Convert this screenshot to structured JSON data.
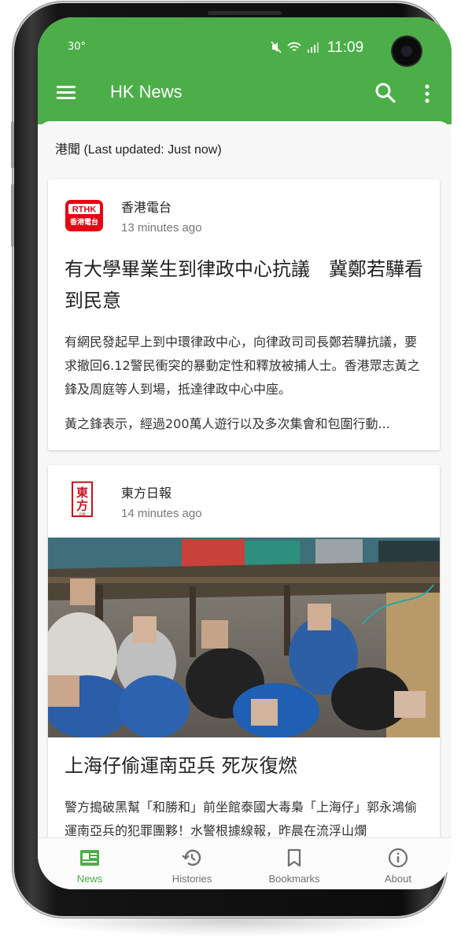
{
  "status_bar": {
    "temperature": "30°",
    "icons": [
      "mute-icon",
      "wifi-icon",
      "signal-icon"
    ],
    "time": "11:09"
  },
  "app_bar": {
    "title": "HK News"
  },
  "section": {
    "header": "港聞 (Last updated: Just now)"
  },
  "articles": [
    {
      "source_name": "香港電台",
      "source_logo_text": "RTHK 香港電台",
      "time_ago": "13 minutes ago",
      "headline": "有大學畢業生到律政中心抗議　冀鄭若驊看到民意",
      "paragraphs": [
        "有網民發起早上到中環律政中心，向律政司司長鄭若驊抗議，要求撤回6.12警民衝突的暴動定性和釋放被捕人士。香港眾志黃之鋒及周庭等人到場，抵達律政中心中座。",
        "黃之鋒表示，經過200萬人遊行以及多次集會和包圍行動..."
      ]
    },
    {
      "source_name": "東方日報",
      "source_logo_text": "東方日報",
      "time_ago": "14 minutes ago",
      "headline": "上海仔偷運南亞兵 死灰復燃",
      "paragraphs": [
        "警方搗破黑幫「和勝和」前坐館泰國大毒梟「上海仔」郭永鴻偷運南亞兵的犯罪團夥！水警根據線報，昨晨在流浮山爛"
      ]
    }
  ],
  "bottom_nav": {
    "items": [
      {
        "label": "News",
        "icon": "newspaper-icon",
        "active": true
      },
      {
        "label": "Histories",
        "icon": "history-icon",
        "active": false
      },
      {
        "label": "Bookmarks",
        "icon": "bookmark-icon",
        "active": false
      },
      {
        "label": "About",
        "icon": "info-icon",
        "active": false
      }
    ]
  },
  "colors": {
    "primary": "#4cae48",
    "rthk_red": "#e30613",
    "oriental_red": "#c8161d"
  }
}
